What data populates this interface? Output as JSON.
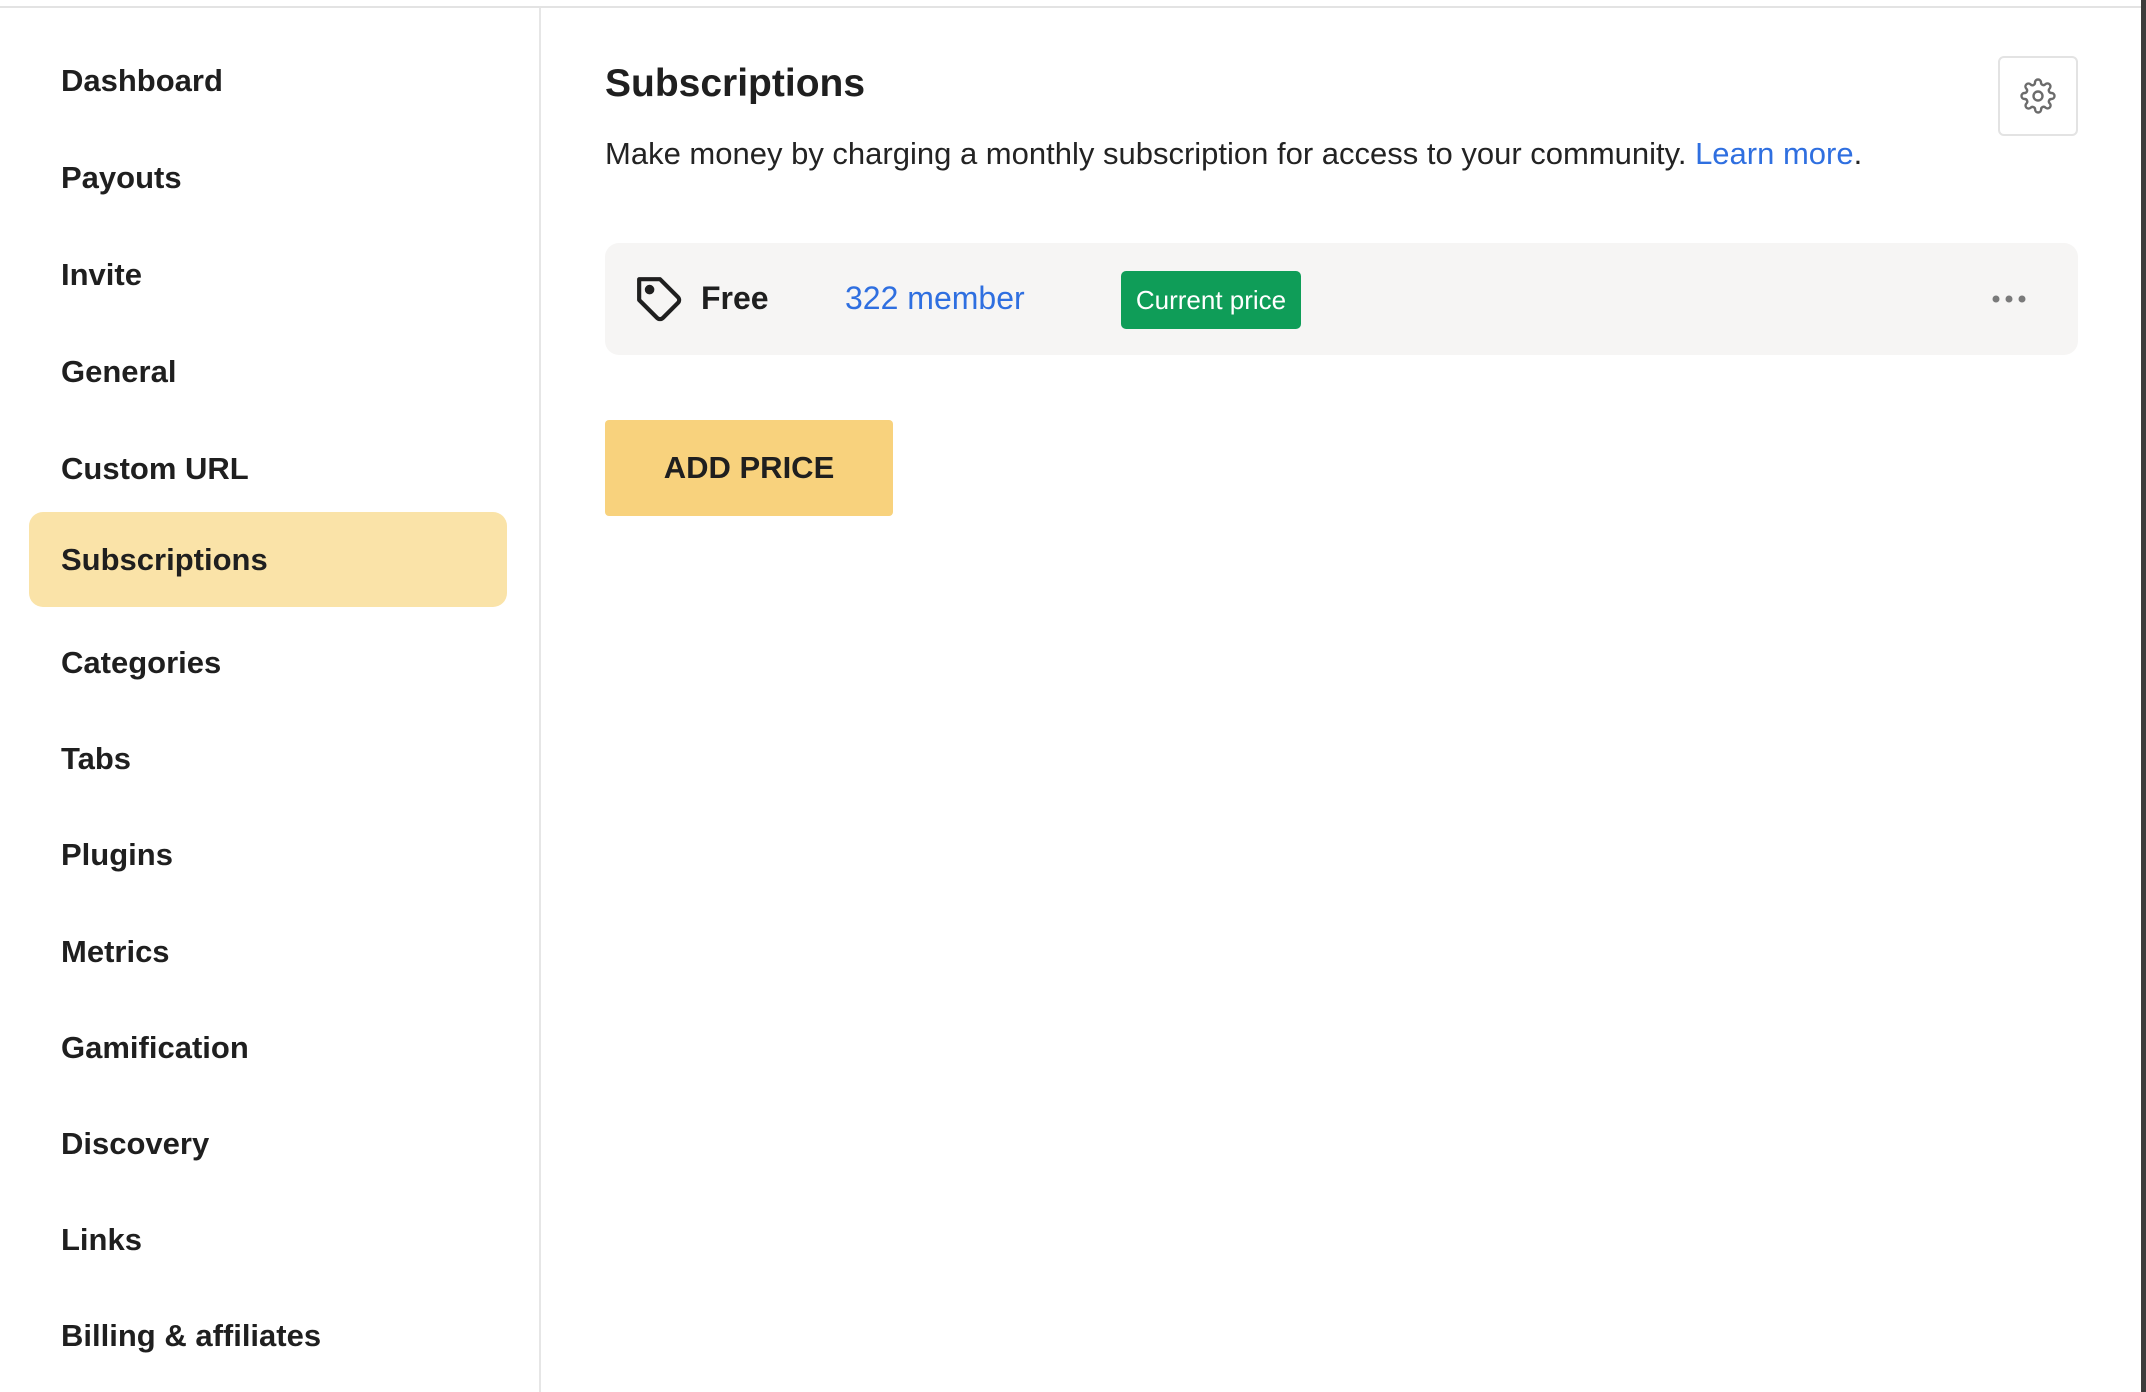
{
  "sidebar": {
    "items": [
      {
        "label": "Dashboard"
      },
      {
        "label": "Payouts"
      },
      {
        "label": "Invite"
      },
      {
        "label": "General"
      },
      {
        "label": "Custom URL"
      },
      {
        "label": "Subscriptions",
        "active": true
      },
      {
        "label": "Categories"
      },
      {
        "label": "Tabs"
      },
      {
        "label": "Plugins"
      },
      {
        "label": "Metrics"
      },
      {
        "label": "Gamification"
      },
      {
        "label": "Discovery"
      },
      {
        "label": "Links"
      },
      {
        "label": "Billing & affiliates"
      }
    ]
  },
  "main": {
    "title": "Subscriptions",
    "description": "Make money by charging a monthly subscription for access to your community. ",
    "learn_more": "Learn more",
    "description_end": ".",
    "settings_icon": "gear-icon",
    "prices": [
      {
        "name": "Free",
        "members": "322 member",
        "badge": "Current price",
        "icon": "tag-icon",
        "menu_icon": "more-horizontal-icon"
      }
    ],
    "add_price_label": "ADD PRICE"
  },
  "colors": {
    "active_nav_bg": "#fae3a8",
    "link": "#2f6fe0",
    "badge_bg": "#0f9d58",
    "primary_button_bg": "#f8d27d"
  }
}
